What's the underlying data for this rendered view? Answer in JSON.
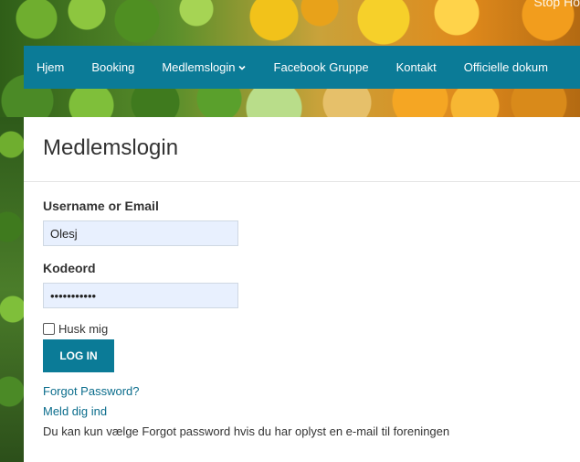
{
  "header": {
    "top_right_text": "Stop Ho"
  },
  "nav": {
    "items": [
      {
        "label": "Hjem"
      },
      {
        "label": "Booking"
      },
      {
        "label": "Medlemslogin",
        "has_dropdown": true
      },
      {
        "label": "Facebook Gruppe"
      },
      {
        "label": "Kontakt"
      },
      {
        "label": "Officielle dokum"
      }
    ]
  },
  "page": {
    "title": "Medlemslogin"
  },
  "form": {
    "username_label": "Username or Email",
    "username_value": "Olesj",
    "password_label": "Kodeord",
    "password_value": "•••••••••••",
    "remember_label": "Husk mig",
    "remember_checked": false,
    "login_button": "LOG IN"
  },
  "links": {
    "forgot_password": "Forgot Password?",
    "register": "Meld dig ind"
  },
  "note": "Du kan kun vælge Forgot password hvis du har oplyst en e-mail til foreningen",
  "colors": {
    "nav_bg": "#0b7b97",
    "button_bg": "#0b7b97",
    "link": "#0b6d8c",
    "input_bg": "#e8f0fe"
  }
}
